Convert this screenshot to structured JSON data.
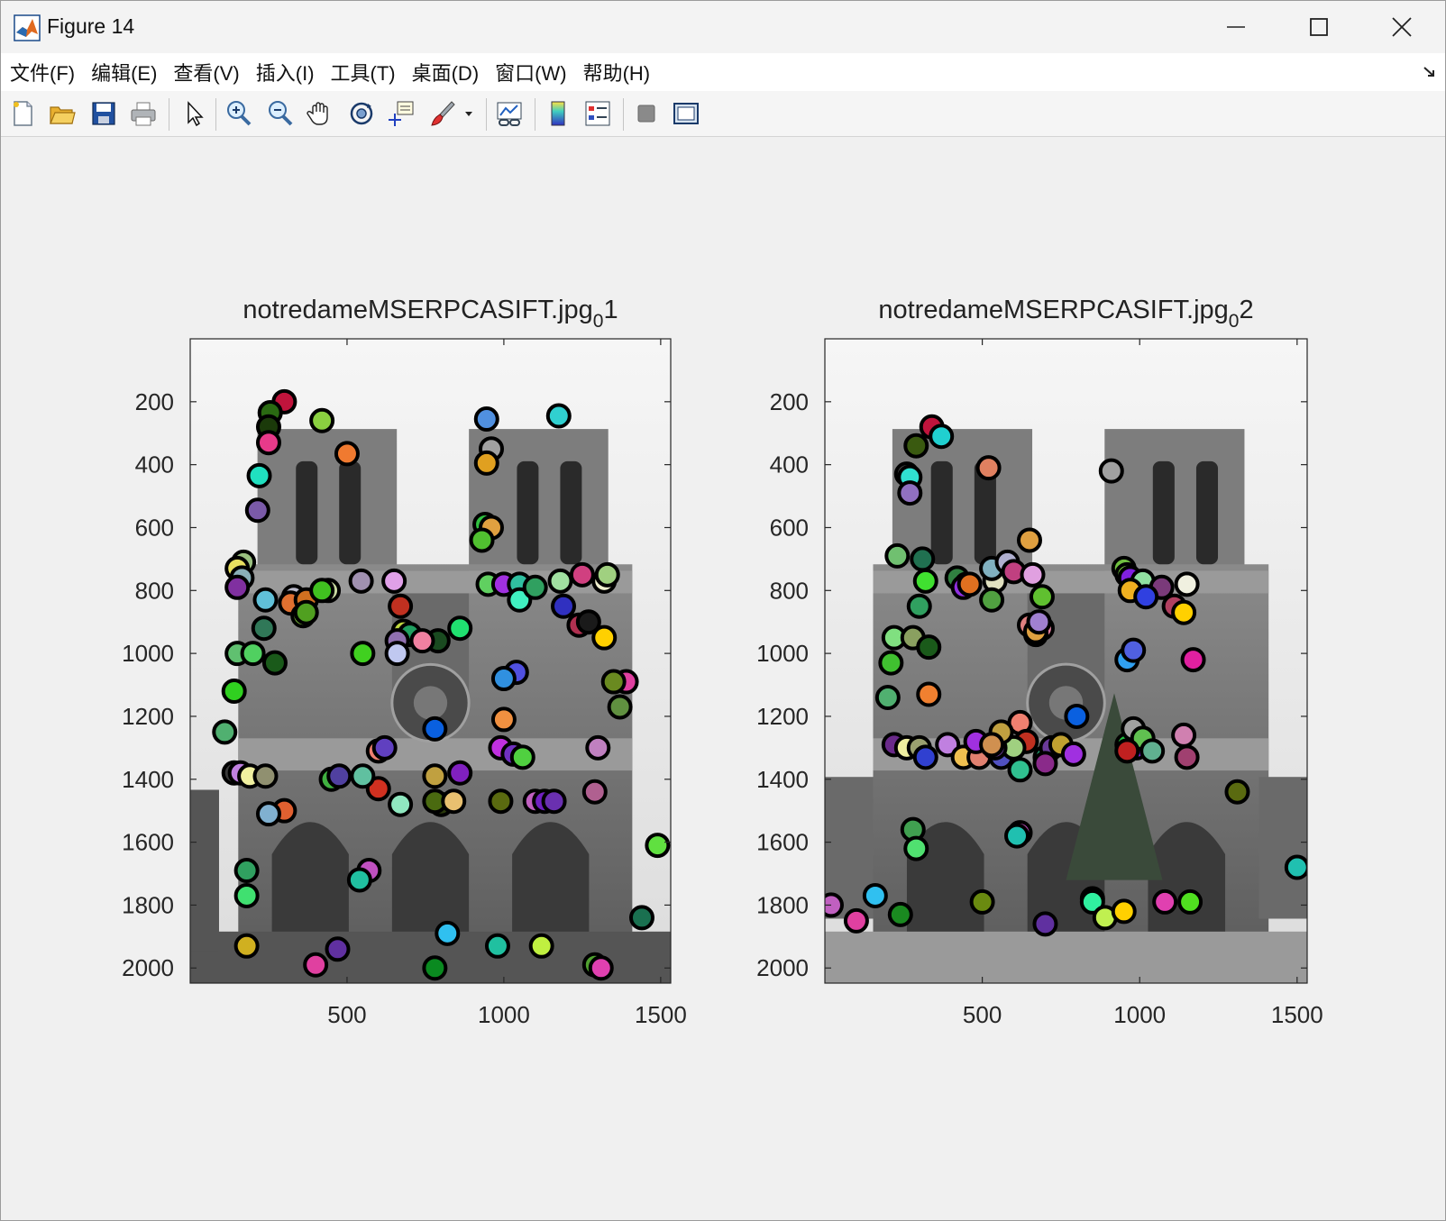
{
  "window": {
    "title": "Figure 14",
    "icon": "matlab-icon"
  },
  "menu": {
    "items": [
      "文件(F)",
      "编辑(E)",
      "查看(V)",
      "插入(I)",
      "工具(T)",
      "桌面(D)",
      "窗口(W)",
      "帮助(H)"
    ]
  },
  "toolbar": {
    "icons": [
      "new-figure-icon",
      "open-file-icon",
      "save-icon",
      "print-icon",
      "select-pointer-icon",
      "zoom-in-icon",
      "zoom-out-icon",
      "pan-hand-icon",
      "rotate-3d-icon",
      "data-cursor-icon",
      "brush-icon",
      "brush-dropdown-icon",
      "link-plot-icon",
      "colorbar-icon",
      "legend-icon",
      "hide-plot-tools-icon",
      "show-plot-tools-icon"
    ]
  },
  "chart_data": [
    {
      "type": "scatter",
      "title_main": "notredameMSERPCASIFT.jpg",
      "title_sub": "0",
      "title_tail": "1",
      "xticks": [
        "500",
        "1000",
        "1500"
      ],
      "yticks": [
        "200",
        "400",
        "600",
        "800",
        "1000",
        "1200",
        "1400",
        "1600",
        "1800",
        "2000"
      ],
      "xlim": [
        0,
        1532
      ],
      "ylim": [
        0,
        2048
      ],
      "y_reversed": true,
      "background": "grayscale photograph of Notre-Dame cathedral facade",
      "marker": "filled circle with black edge",
      "points": [
        [
          300,
          200,
          "#c0143c"
        ],
        [
          255,
          235,
          "#2a6a12"
        ],
        [
          250,
          280,
          "#1b3a0a"
        ],
        [
          250,
          330,
          "#e83a8a"
        ],
        [
          420,
          260,
          "#8ad040"
        ],
        [
          500,
          365,
          "#f07a30"
        ],
        [
          220,
          435,
          "#20e0c0"
        ],
        [
          215,
          545,
          "#7a5aa8"
        ],
        [
          170,
          710,
          "#9ac080"
        ],
        [
          150,
          730,
          "#e8e060"
        ],
        [
          165,
          760,
          "#8ab0b8"
        ],
        [
          150,
          790,
          "#8030a0"
        ],
        [
          240,
          830,
          "#60c0d8"
        ],
        [
          330,
          820,
          "#b8b8c8"
        ],
        [
          320,
          840,
          "#e07030"
        ],
        [
          370,
          830,
          "#d07020"
        ],
        [
          440,
          800,
          "#c8d8a0"
        ],
        [
          420,
          800,
          "#40c020"
        ],
        [
          545,
          770,
          "#a090b0"
        ],
        [
          650,
          770,
          "#e0a0e8"
        ],
        [
          670,
          850,
          "#c03020"
        ],
        [
          360,
          880,
          "#80c040"
        ],
        [
          370,
          870,
          "#50a020"
        ],
        [
          235,
          920,
          "#307858"
        ],
        [
          680,
          930,
          "#c0d840"
        ],
        [
          700,
          940,
          "#20a060"
        ],
        [
          790,
          960,
          "#1a4a20"
        ],
        [
          860,
          920,
          "#20e070"
        ],
        [
          740,
          960,
          "#f080a0"
        ],
        [
          660,
          960,
          "#9070b0"
        ],
        [
          660,
          1000,
          "#c0c8f0"
        ],
        [
          550,
          1000,
          "#40d020"
        ],
        [
          150,
          1000,
          "#60c070"
        ],
        [
          200,
          1000,
          "#50d060"
        ],
        [
          270,
          1030,
          "#1a5a1a"
        ],
        [
          140,
          1120,
          "#30d020"
        ],
        [
          110,
          1250,
          "#50b070"
        ],
        [
          950,
          780,
          "#60d060"
        ],
        [
          1000,
          780,
          "#a030e0"
        ],
        [
          1050,
          780,
          "#30c0a0"
        ],
        [
          1050,
          830,
          "#40f0c0"
        ],
        [
          1100,
          790,
          "#30a060"
        ],
        [
          1180,
          770,
          "#a0e0a0"
        ],
        [
          1250,
          750,
          "#d04080"
        ],
        [
          1320,
          770,
          "#f0f0d0"
        ],
        [
          1330,
          750,
          "#a0d080"
        ],
        [
          1190,
          850,
          "#3030c0"
        ],
        [
          1240,
          910,
          "#b03050"
        ],
        [
          1270,
          900,
          "#1a1a1a"
        ],
        [
          1320,
          950,
          "#ffd000"
        ],
        [
          1390,
          1090,
          "#e040a0"
        ],
        [
          1350,
          1090,
          "#6a8a20"
        ],
        [
          1370,
          1170,
          "#609040"
        ],
        [
          1040,
          1060,
          "#5050e0"
        ],
        [
          1000,
          1080,
          "#3090e0"
        ],
        [
          1000,
          1210,
          "#f09040"
        ],
        [
          990,
          1300,
          "#c030e0"
        ],
        [
          1030,
          1320,
          "#7030c0"
        ],
        [
          1060,
          1330,
          "#50d040"
        ],
        [
          1300,
          1300,
          "#c080c0"
        ],
        [
          1290,
          1440,
          "#b06090"
        ],
        [
          940,
          590,
          "#30c040"
        ],
        [
          960,
          600,
          "#e0a040"
        ],
        [
          930,
          640,
          "#50c030"
        ],
        [
          945,
          255,
          "#5090e0"
        ],
        [
          960,
          350,
          "#a0a0a0"
        ],
        [
          945,
          395,
          "#e0a020"
        ],
        [
          1175,
          245,
          "#30d0d0"
        ],
        [
          780,
          1240,
          "#0a60e0"
        ],
        [
          600,
          1310,
          "#f08070"
        ],
        [
          620,
          1300,
          "#6040c0"
        ],
        [
          600,
          1430,
          "#d03020"
        ],
        [
          450,
          1400,
          "#40b040"
        ],
        [
          475,
          1390,
          "#5040a0"
        ],
        [
          550,
          1390,
          "#60c0a0"
        ],
        [
          670,
          1480,
          "#90e8c0"
        ],
        [
          780,
          1390,
          "#c0a040"
        ],
        [
          860,
          1380,
          "#8020c0"
        ],
        [
          800,
          1480,
          "#2a3a0a"
        ],
        [
          780,
          1470,
          "#4a6a10"
        ],
        [
          840,
          1470,
          "#e8c070"
        ],
        [
          990,
          1470,
          "#5a6a10"
        ],
        [
          1100,
          1470,
          "#c060c0"
        ],
        [
          1130,
          1470,
          "#7020c0"
        ],
        [
          1160,
          1470,
          "#6a30b0"
        ],
        [
          140,
          1380,
          "#3a3a3a"
        ],
        [
          160,
          1380,
          "#c080e0"
        ],
        [
          190,
          1390,
          "#f0f0a0"
        ],
        [
          240,
          1390,
          "#909070"
        ],
        [
          300,
          1500,
          "#e06030"
        ],
        [
          250,
          1510,
          "#80b0d0"
        ],
        [
          180,
          1690,
          "#30a060"
        ],
        [
          180,
          1770,
          "#40e070"
        ],
        [
          570,
          1690,
          "#c050c0"
        ],
        [
          540,
          1720,
          "#20c0a0"
        ],
        [
          180,
          1930,
          "#d0b020"
        ],
        [
          400,
          1990,
          "#e040a0"
        ],
        [
          470,
          1940,
          "#6030a0"
        ],
        [
          780,
          2000,
          "#0a8a20"
        ],
        [
          820,
          1890,
          "#30c0f0"
        ],
        [
          980,
          1930,
          "#20c0a0"
        ],
        [
          1120,
          1930,
          "#c0f040"
        ],
        [
          1290,
          1990,
          "#50a030"
        ],
        [
          1310,
          2000,
          "#e040b0"
        ],
        [
          1440,
          1840,
          "#1a7050"
        ],
        [
          1490,
          1610,
          "#60e040"
        ]
      ]
    },
    {
      "type": "scatter",
      "title_main": "notredameMSERPCASIFT.jpg",
      "title_sub": "0",
      "title_tail": "2",
      "xticks": [
        "500",
        "1000",
        "1500"
      ],
      "yticks": [
        "200",
        "400",
        "600",
        "800",
        "1000",
        "1200",
        "1400",
        "1600",
        "1800",
        "2000"
      ],
      "xlim": [
        0,
        1532
      ],
      "ylim": [
        0,
        2048
      ],
      "y_reversed": true,
      "background": "grayscale photograph of Notre-Dame cathedral facade",
      "marker": "filled circle with black edge",
      "points": [
        [
          340,
          280,
          "#c0143c"
        ],
        [
          370,
          310,
          "#20d0d0"
        ],
        [
          290,
          340,
          "#3a5a10"
        ],
        [
          260,
          430,
          "#4a4a4a"
        ],
        [
          270,
          440,
          "#30e0d0"
        ],
        [
          270,
          490,
          "#9070c0"
        ],
        [
          520,
          410,
          "#e08060"
        ],
        [
          910,
          420,
          "#a0a0a0"
        ],
        [
          650,
          640,
          "#e0a040"
        ],
        [
          230,
          690,
          "#70c070"
        ],
        [
          310,
          700,
          "#207050"
        ],
        [
          320,
          770,
          "#40e030"
        ],
        [
          420,
          760,
          "#308040"
        ],
        [
          450,
          780,
          "#20a040"
        ],
        [
          440,
          790,
          "#9030e0"
        ],
        [
          460,
          780,
          "#e07020"
        ],
        [
          540,
          770,
          "#e0e0c0"
        ],
        [
          530,
          730,
          "#80b0c0"
        ],
        [
          580,
          710,
          "#b0b0d0"
        ],
        [
          600,
          740,
          "#c04080"
        ],
        [
          660,
          750,
          "#e0a0e0"
        ],
        [
          690,
          820,
          "#60c030"
        ],
        [
          530,
          830,
          "#50a040"
        ],
        [
          300,
          850,
          "#30a060"
        ],
        [
          220,
          950,
          "#80e080"
        ],
        [
          280,
          950,
          "#8aa060"
        ],
        [
          330,
          980,
          "#1a5a1a"
        ],
        [
          210,
          1030,
          "#40c030"
        ],
        [
          200,
          1140,
          "#50b070"
        ],
        [
          330,
          1130,
          "#f08030"
        ],
        [
          650,
          910,
          "#e08080"
        ],
        [
          690,
          920,
          "#e080a0"
        ],
        [
          670,
          940,
          "#2a2a2a"
        ],
        [
          670,
          930,
          "#e0a040"
        ],
        [
          680,
          900,
          "#a080d0"
        ],
        [
          950,
          730,
          "#70c040"
        ],
        [
          960,
          750,
          "#80e040"
        ],
        [
          970,
          760,
          "#8020e0"
        ],
        [
          1010,
          770,
          "#90e0a0"
        ],
        [
          1070,
          790,
          "#7a3a7a"
        ],
        [
          970,
          800,
          "#f0b020"
        ],
        [
          1020,
          820,
          "#3040e0"
        ],
        [
          1110,
          850,
          "#b04060"
        ],
        [
          1140,
          870,
          "#ffd000"
        ],
        [
          1150,
          780,
          "#f0f0e0"
        ],
        [
          1170,
          1020,
          "#e020a0"
        ],
        [
          960,
          1020,
          "#30a0f0"
        ],
        [
          980,
          990,
          "#5060e0"
        ],
        [
          800,
          1200,
          "#0a60e0"
        ],
        [
          620,
          1220,
          "#f08070"
        ],
        [
          560,
          1330,
          "#5050c0"
        ],
        [
          640,
          1280,
          "#c03020"
        ],
        [
          600,
          1300,
          "#a0d080"
        ],
        [
          700,
          1330,
          "#20a070"
        ],
        [
          720,
          1300,
          "#6a3a9a"
        ],
        [
          750,
          1290,
          "#c0a030"
        ],
        [
          790,
          1320,
          "#a030e0"
        ],
        [
          960,
          1290,
          "#20c040"
        ],
        [
          990,
          1300,
          "#8020e0"
        ],
        [
          980,
          1240,
          "#a0a0a0"
        ],
        [
          1010,
          1270,
          "#60c050"
        ],
        [
          1040,
          1310,
          "#60b090"
        ],
        [
          960,
          1310,
          "#c02020"
        ],
        [
          1140,
          1260,
          "#d080b0"
        ],
        [
          1150,
          1330,
          "#a04070"
        ],
        [
          220,
          1290,
          "#6a2a8a"
        ],
        [
          260,
          1300,
          "#f0f0a0"
        ],
        [
          300,
          1300,
          "#9aa070"
        ],
        [
          320,
          1330,
          "#3040d0"
        ],
        [
          390,
          1290,
          "#c080e0"
        ],
        [
          440,
          1330,
          "#f0c050"
        ],
        [
          490,
          1330,
          "#e08070"
        ],
        [
          480,
          1280,
          "#a030e0"
        ],
        [
          540,
          1300,
          "#6a3a9a"
        ],
        [
          560,
          1250,
          "#c0a040"
        ],
        [
          530,
          1290,
          "#d09050"
        ],
        [
          620,
          1370,
          "#30c090"
        ],
        [
          700,
          1350,
          "#8a2a8a"
        ],
        [
          1310,
          1440,
          "#5a6a10"
        ],
        [
          280,
          1560,
          "#40a050"
        ],
        [
          290,
          1620,
          "#50e070"
        ],
        [
          620,
          1570,
          "#c050c0"
        ],
        [
          610,
          1580,
          "#20c0b0"
        ],
        [
          500,
          1790,
          "#6a8a10"
        ],
        [
          850,
          1780,
          "#f0d040"
        ],
        [
          850,
          1790,
          "#30f0a0"
        ],
        [
          890,
          1840,
          "#c0f050"
        ],
        [
          950,
          1820,
          "#ffd000"
        ],
        [
          1080,
          1790,
          "#e040b0"
        ],
        [
          1160,
          1790,
          "#50e020"
        ],
        [
          20,
          1800,
          "#c060c0"
        ],
        [
          100,
          1850,
          "#e040a0"
        ],
        [
          160,
          1770,
          "#30c0f0"
        ],
        [
          240,
          1830,
          "#1a8a20"
        ],
        [
          700,
          1860,
          "#6030a0"
        ],
        [
          1500,
          1680,
          "#20c0b0"
        ]
      ]
    }
  ]
}
